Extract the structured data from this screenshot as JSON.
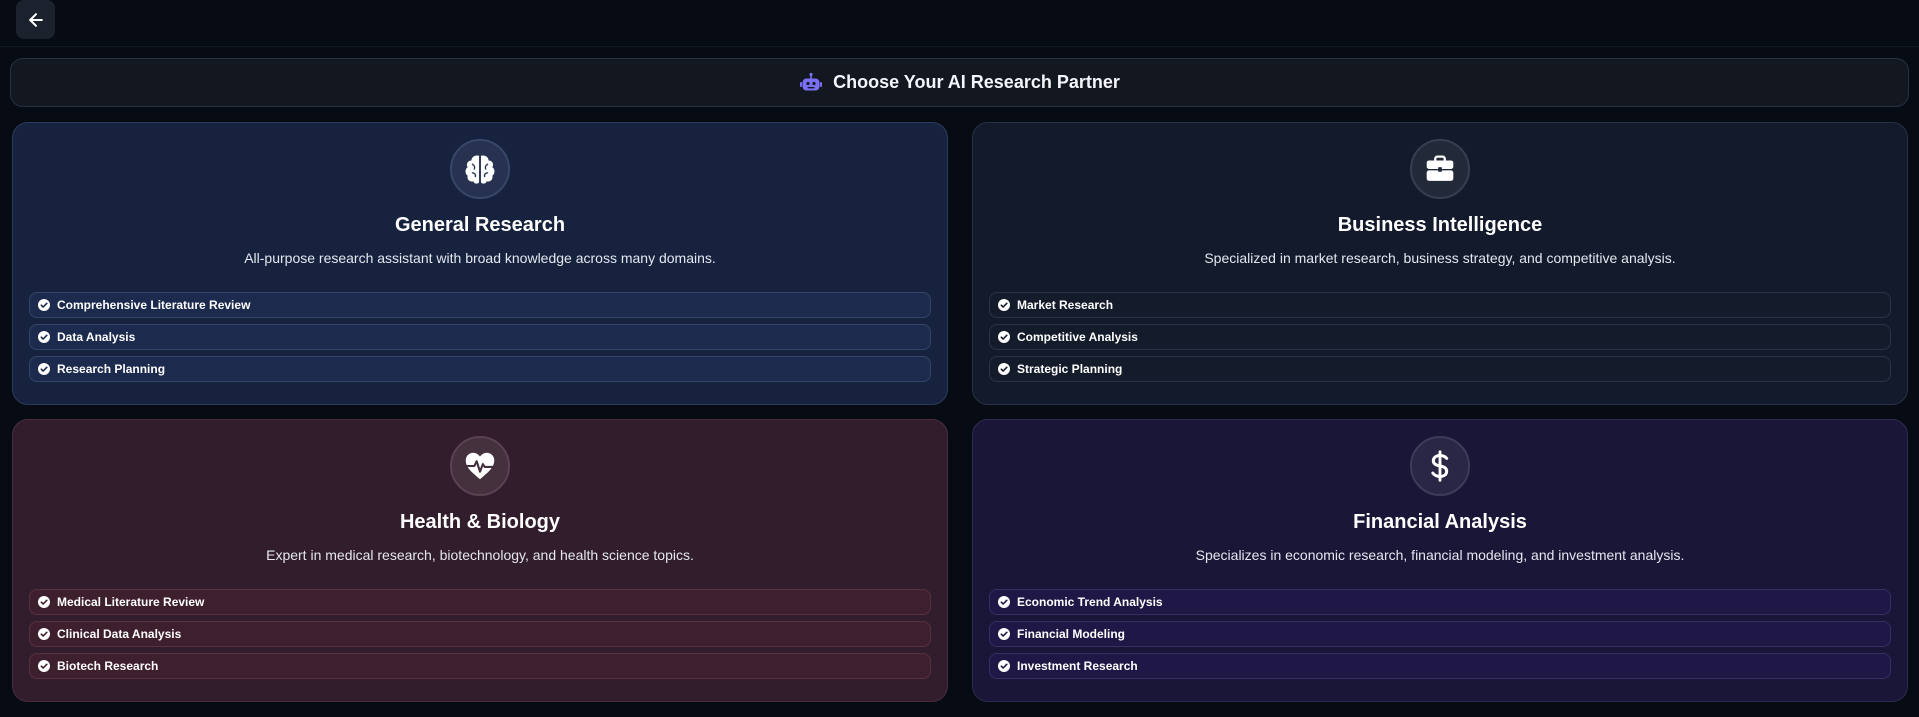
{
  "header": {
    "title": "Choose Your AI Research Partner"
  },
  "cards": [
    {
      "title": "General Research",
      "description": "All-purpose research assistant with broad knowledge across many domains.",
      "icon": "brain-icon",
      "features": [
        "Comprehensive Literature Review",
        "Data Analysis",
        "Research Planning"
      ]
    },
    {
      "title": "Business Intelligence",
      "description": "Specialized in market research, business strategy, and competitive analysis.",
      "icon": "briefcase-icon",
      "features": [
        "Market Research",
        "Competitive Analysis",
        "Strategic Planning"
      ]
    },
    {
      "title": "Health & Biology",
      "description": "Expert in medical research, biotechnology, and health science topics.",
      "icon": "heart-pulse-icon",
      "features": [
        "Medical Literature Review",
        "Clinical Data Analysis",
        "Biotech Research"
      ]
    },
    {
      "title": "Financial Analysis",
      "description": "Specializes in economic research, financial modeling, and investment analysis.",
      "icon": "dollar-icon",
      "features": [
        "Economic Trend Analysis",
        "Financial Modeling",
        "Investment Research"
      ]
    }
  ],
  "colors": {
    "accent": "#7b6ff5",
    "background": "#070b14"
  }
}
